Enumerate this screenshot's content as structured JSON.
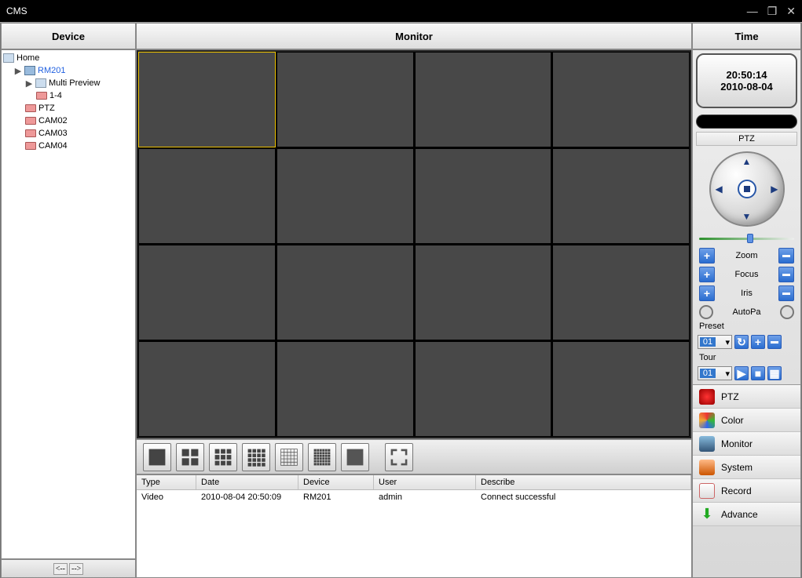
{
  "titlebar": {
    "title": "CMS"
  },
  "sections": {
    "device": "Device",
    "monitor": "Monitor",
    "time": "Time"
  },
  "tree": {
    "root": "Home",
    "device": "RM201",
    "multi": "Multi Preview",
    "range": "1-4",
    "ptz": "PTZ",
    "cam02": "CAM02",
    "cam03": "CAM03",
    "cam04": "CAM04"
  },
  "nav": {
    "prev": "<--",
    "next": "-->"
  },
  "time": {
    "clock": "20:50:14",
    "date": "2010-08-04"
  },
  "ptz": {
    "label": "PTZ",
    "zoom": "Zoom",
    "focus": "Focus",
    "iris": "Iris",
    "autopan": "AutoPa",
    "preset_label": "Preset",
    "tour_label": "Tour",
    "preset_value": "01",
    "tour_value": "01"
  },
  "rmenu": {
    "ptz": "PTZ",
    "color": "Color",
    "monitor": "Monitor",
    "system": "System",
    "record": "Record",
    "advance": "Advance"
  },
  "log": {
    "headers": {
      "type": "Type",
      "date": "Date",
      "device": "Device",
      "user": "User",
      "describe": "Describe"
    },
    "rows": [
      {
        "type": "Video",
        "date": "2010-08-04 20:50:09",
        "device": "RM201",
        "user": "admin",
        "describe": "Connect successful"
      }
    ]
  }
}
